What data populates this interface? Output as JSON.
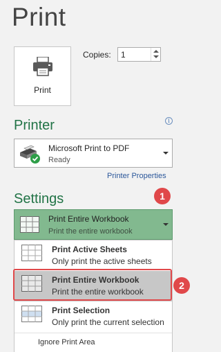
{
  "header": {
    "title": "Print"
  },
  "print_button": {
    "label": "Print",
    "icon": "printer-icon"
  },
  "copies": {
    "label": "Copies:",
    "value": "1"
  },
  "printer": {
    "section_title": "Printer",
    "name": "Microsoft Print to PDF",
    "status": "Ready",
    "properties_link": "Printer Properties",
    "info_glyph": "i"
  },
  "settings": {
    "section_title": "Settings",
    "selected_title": "Print Entire Workbook",
    "selected_desc": "Print the entire workbook",
    "menu": [
      {
        "title": "Print Active Sheets",
        "desc": "Only print the active sheets"
      },
      {
        "title": "Print Entire Workbook",
        "desc": "Print the entire workbook"
      },
      {
        "title": "Print Selection",
        "desc": "Only print the current selection"
      }
    ],
    "ignore_print_area": "Ignore Print Area"
  },
  "callouts": [
    "1",
    "2"
  ],
  "colors": {
    "accent": "#217346",
    "selected_dd": "#82b98f",
    "callout": "#e0484a",
    "link": "#2b579a"
  }
}
